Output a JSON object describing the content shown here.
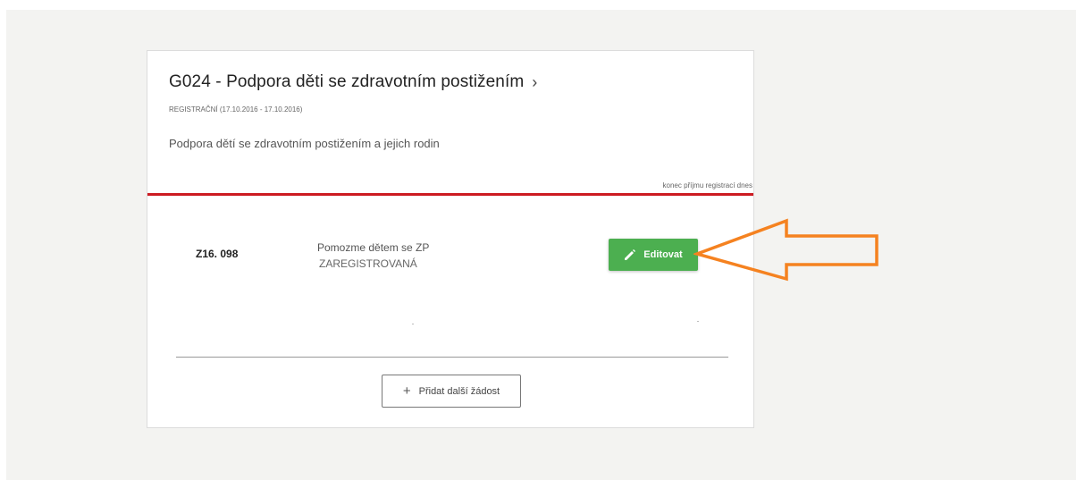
{
  "program": {
    "title": "G024 - Podpora děti se zdravotním postižením",
    "chevron": "›",
    "subtitle": "REGISTRAČNÍ (17.10.2016 - 17.10.2016)",
    "description": "Podpora dětí se zdravotním postižením a jejich rodin",
    "deadline_note": "konec příjmu registrací dnes"
  },
  "request": {
    "code": "Z16. 098",
    "name": "Pomozme dětem se ZP",
    "status": "ZAREGISTROVANÁ",
    "edit_label": "Editovat"
  },
  "footer": {
    "add_label": "Přidat další žádost",
    "add_icon": "+"
  },
  "icons": {
    "edit": "pencil-icon",
    "add": "plus-icon",
    "annotation": "arrow-left-icon"
  },
  "colors": {
    "accent_red": "#cc1b22",
    "button_green": "#4caf50",
    "annotation_orange": "#f58220"
  }
}
